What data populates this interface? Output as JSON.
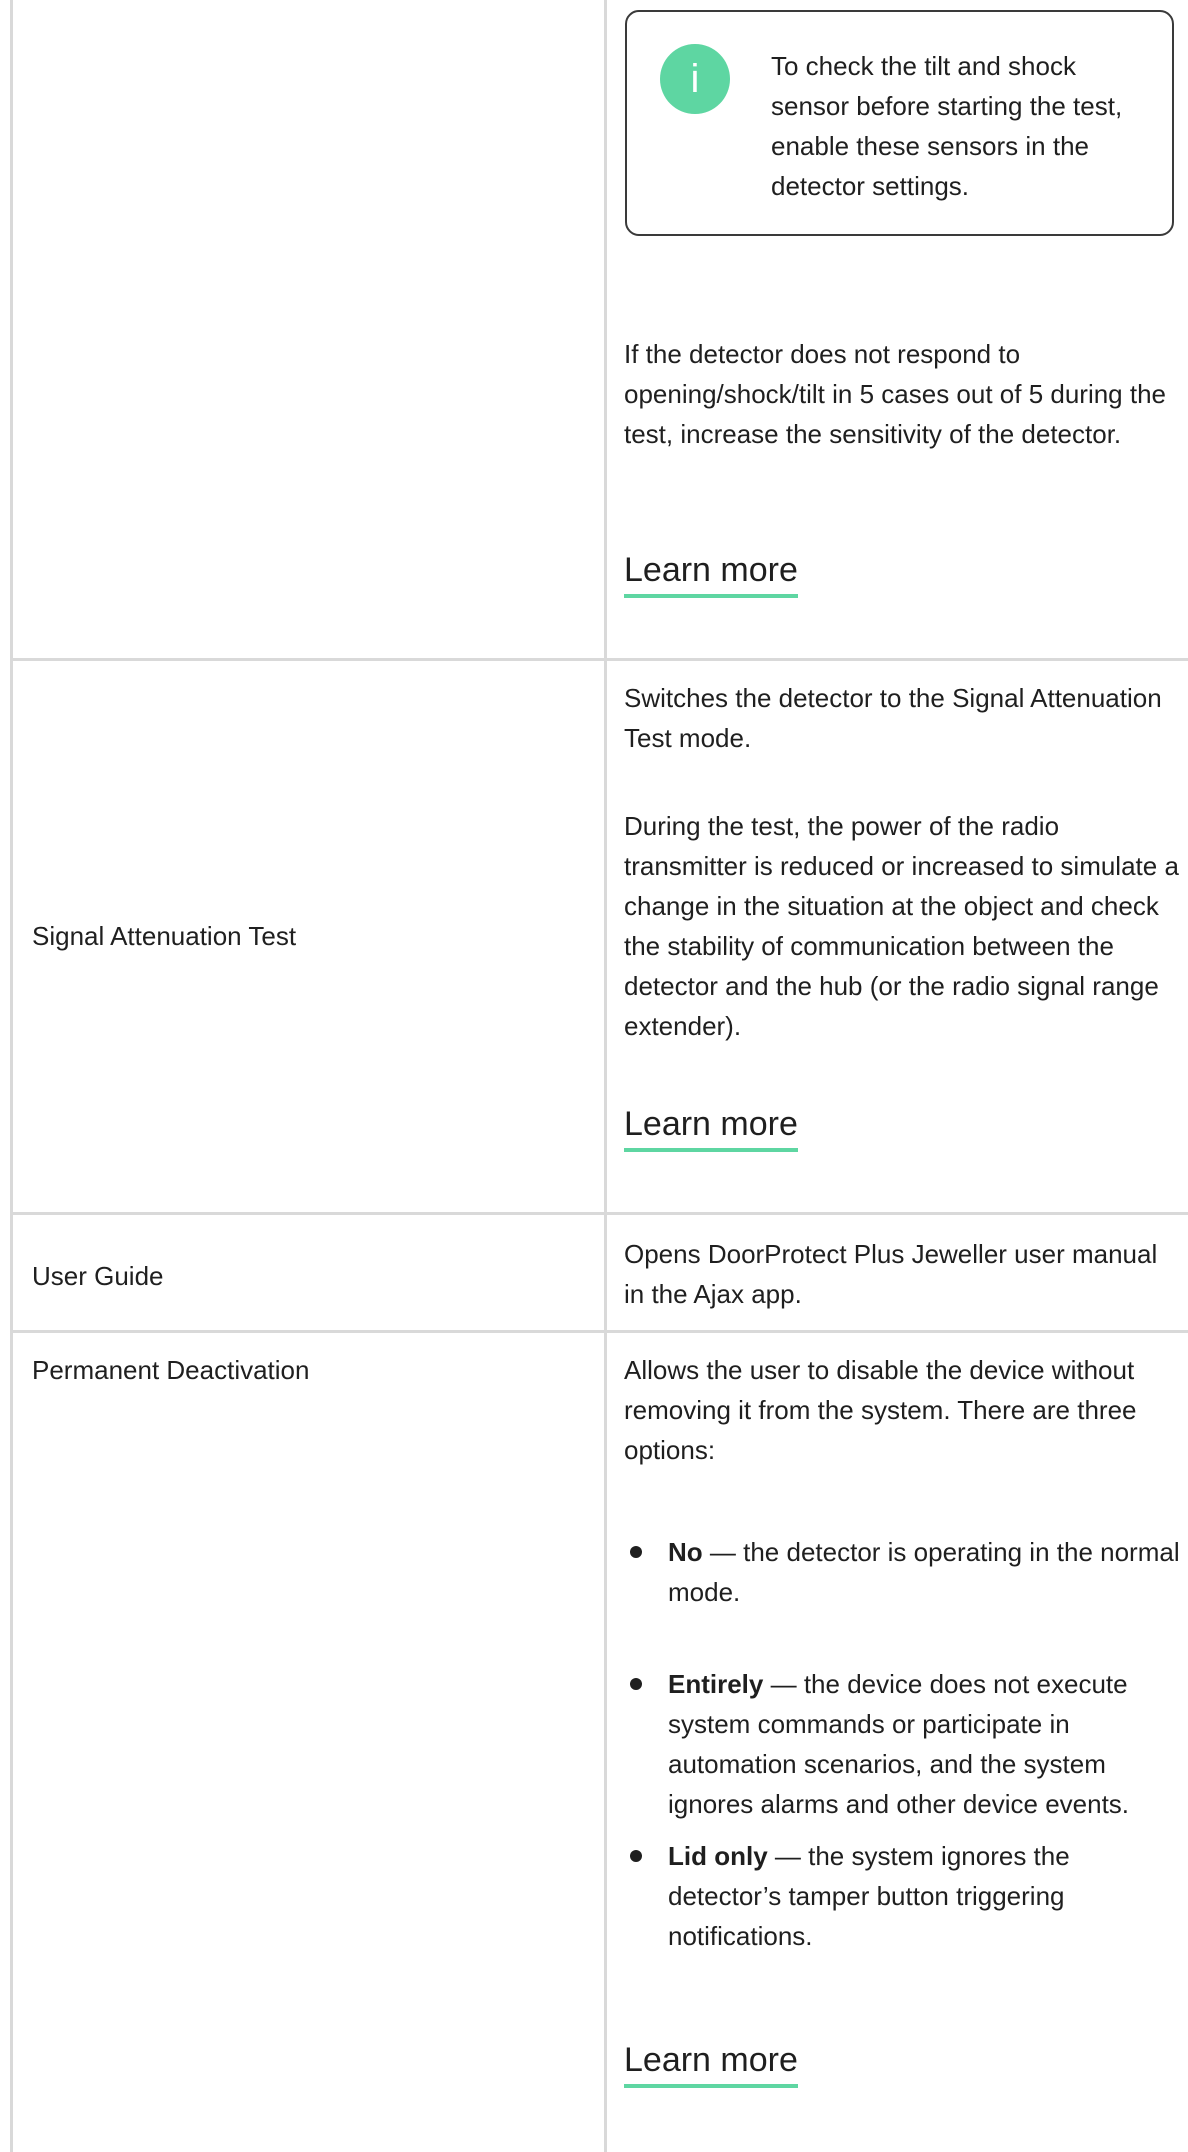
{
  "note": {
    "icon": "info-icon",
    "icon_glyph": "i",
    "text": "To check the tilt and shock sensor before starting the test, enable these sensors in the detector settings."
  },
  "row_detection_test": {
    "description": "If the detector does not respond to opening/shock/tilt in 5 cases out of 5 during the test, increase the sensitivity of the detector.",
    "learn_more": "Learn more"
  },
  "row_signal_attenuation": {
    "label": "Signal Attenuation Test",
    "description_1": "Switches the detector to the Signal Attenuation Test mode.",
    "description_2": "During the test, the power of the radio transmitter is reduced or increased to simulate a change in the situation at the object and check the stability of communication between the detector and the hub (or the radio signal range extender).",
    "learn_more": "Learn more"
  },
  "row_user_guide": {
    "label": "User Guide",
    "description": "Opens DoorProtect Plus Jeweller user manual in the Ajax app."
  },
  "row_permanent_deactivation": {
    "label": "Permanent Deactivation",
    "description": "Allows the user to disable the device without removing it from the system. There are three options:",
    "options": [
      {
        "term": "No",
        "text": " — the detector is operating in the normal mode."
      },
      {
        "term": "Entirely",
        "text": " — the device does not execute system commands or participate in automation scenarios, and the system ignores alarms and other device events."
      },
      {
        "term": "Lid only",
        "text": " — the system ignores the detector’s tamper button triggering notifications."
      }
    ],
    "learn_more": "Learn more"
  }
}
